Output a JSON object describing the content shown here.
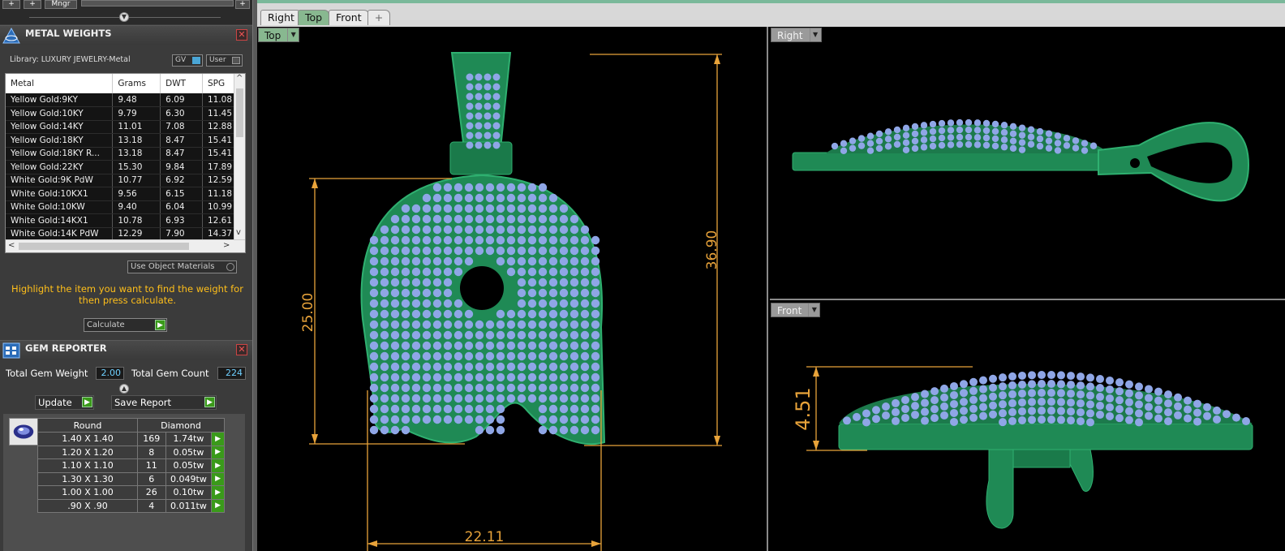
{
  "toolbar": {
    "plus1": "+",
    "plus2": "+",
    "mngr": "Mngr",
    "plus3": "+"
  },
  "metal_panel": {
    "title": "METAL WEIGHTS",
    "library": "Library: LUXURY JEWELRY-Metal",
    "gv": "GV",
    "user": "User",
    "columns": [
      "Metal",
      "Grams",
      "DWT",
      "SPG"
    ],
    "rows": [
      [
        "Yellow Gold:9KY",
        "9.48",
        "6.09",
        "11.08"
      ],
      [
        "Yellow Gold:10KY",
        "9.79",
        "6.30",
        "11.45"
      ],
      [
        "Yellow Gold:14KY",
        "11.01",
        "7.08",
        "12.88"
      ],
      [
        "Yellow Gold:18KY",
        "13.18",
        "8.47",
        "15.41"
      ],
      [
        "Yellow Gold:18KY R...",
        "13.18",
        "8.47",
        "15.41"
      ],
      [
        "Yellow Gold:22KY",
        "15.30",
        "9.84",
        "17.89"
      ],
      [
        "White Gold:9K PdW",
        "10.77",
        "6.92",
        "12.59"
      ],
      [
        "White Gold:10KX1",
        "9.56",
        "6.15",
        "11.18"
      ],
      [
        "White Gold:10KW",
        "9.40",
        "6.04",
        "10.99"
      ],
      [
        "White Gold:14KX1",
        "10.78",
        "6.93",
        "12.61"
      ],
      [
        "White Gold:14K PdW",
        "12.29",
        "7.90",
        "14.37"
      ]
    ],
    "use_object_materials": "Use Object Materials",
    "hint": "Highlight the item you want to find the weight for then press calculate.",
    "calculate": "Calculate"
  },
  "gem_panel": {
    "title": "GEM REPORTER",
    "total_weight_label": "Total Gem Weight",
    "total_weight": "2.00",
    "total_count_label": "Total Gem Count",
    "total_count": "224",
    "update": "Update",
    "save_report": "Save Report",
    "shape": "Round",
    "material": "Diamond",
    "rows": [
      [
        "1.40 X 1.40",
        "169",
        "1.74tw"
      ],
      [
        "1.20 X 1.20",
        "8",
        "0.05tw"
      ],
      [
        "1.10 X 1.10",
        "11",
        "0.05tw"
      ],
      [
        "1.30 X 1.30",
        "6",
        "0.049tw"
      ],
      [
        "1.00 X 1.00",
        "26",
        "0.10tw"
      ],
      [
        ".90 X .90",
        "4",
        "0.011tw"
      ]
    ]
  },
  "view_tabs": [
    "Right",
    "Top",
    "Front",
    "+"
  ],
  "viewports": {
    "top": {
      "label": "Top",
      "dim_height_total": "36.90",
      "dim_height_body": "25.00",
      "dim_width": "22.11"
    },
    "right": {
      "label": "Right"
    },
    "front": {
      "label": "Front",
      "dim_thickness": "4.51"
    }
  },
  "colors": {
    "model_green": "#1f8a55",
    "gem_blue": "#8fa6e6",
    "dimension_orange": "#e8a33a",
    "hint_yellow": "#ffbf1a",
    "active_tab": "#88b890"
  }
}
